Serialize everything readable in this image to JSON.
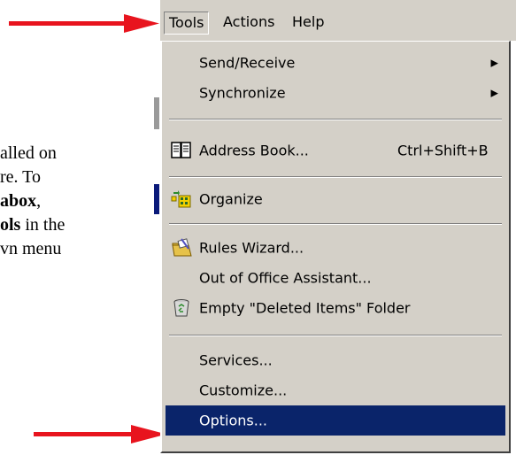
{
  "background_text": {
    "lines": [
      {
        "normal": "alled on",
        "bold": ""
      },
      {
        "normal": "re.  To",
        "bold": ""
      },
      {
        "normal": ",",
        "bold": "abox"
      },
      {
        "normal": " in the",
        "bold": "ols"
      },
      {
        "normal": "vn menu",
        "bold": ""
      }
    ]
  },
  "menubar": {
    "items": [
      "Tools",
      "Actions",
      "Help"
    ]
  },
  "menu": {
    "send_receive": "Send/Receive",
    "synchronize": "Synchronize",
    "address_book": "Address Book...",
    "address_book_shortcut": "Ctrl+Shift+B",
    "organize": "Organize",
    "rules_wizard": "Rules Wizard...",
    "out_of_office": "Out of Office Assistant...",
    "empty_deleted": "Empty \"Deleted Items\" Folder",
    "services": "Services...",
    "customize": "Customize...",
    "options": "Options..."
  },
  "colors": {
    "menu_bg": "#d4d0c8",
    "highlight": "#0a246a",
    "arrow": "#e8141e"
  },
  "icons": {
    "address_book": "address-book-icon",
    "organize": "organize-icon",
    "rules_wizard": "rules-wizard-icon",
    "empty_deleted": "recycle-bin-icon"
  }
}
